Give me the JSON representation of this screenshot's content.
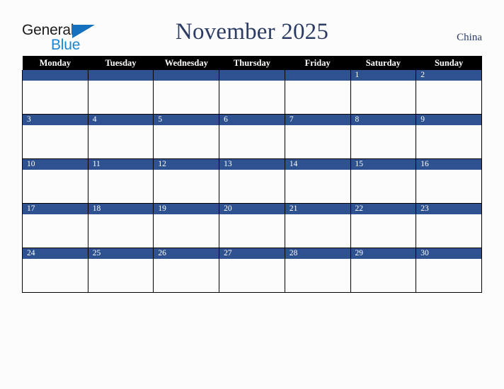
{
  "logo": {
    "word_top": "General",
    "word_bottom": "Blue",
    "triangle_icon": "triangle-icon",
    "brand_blue": "#1b86d4"
  },
  "header": {
    "title": "November 2025",
    "country": "China",
    "title_color": "#2c3c63"
  },
  "calendar": {
    "weekdays": [
      "Monday",
      "Tuesday",
      "Wednesday",
      "Thursday",
      "Friday",
      "Saturday",
      "Sunday"
    ],
    "accent_color": "#2e5190",
    "header_color": "#000000",
    "weeks": [
      [
        "",
        "",
        "",
        "",
        "",
        "1",
        "2"
      ],
      [
        "3",
        "4",
        "5",
        "6",
        "7",
        "8",
        "9"
      ],
      [
        "10",
        "11",
        "12",
        "13",
        "14",
        "15",
        "16"
      ],
      [
        "17",
        "18",
        "19",
        "20",
        "21",
        "22",
        "23"
      ],
      [
        "24",
        "25",
        "26",
        "27",
        "28",
        "29",
        "30"
      ]
    ]
  }
}
